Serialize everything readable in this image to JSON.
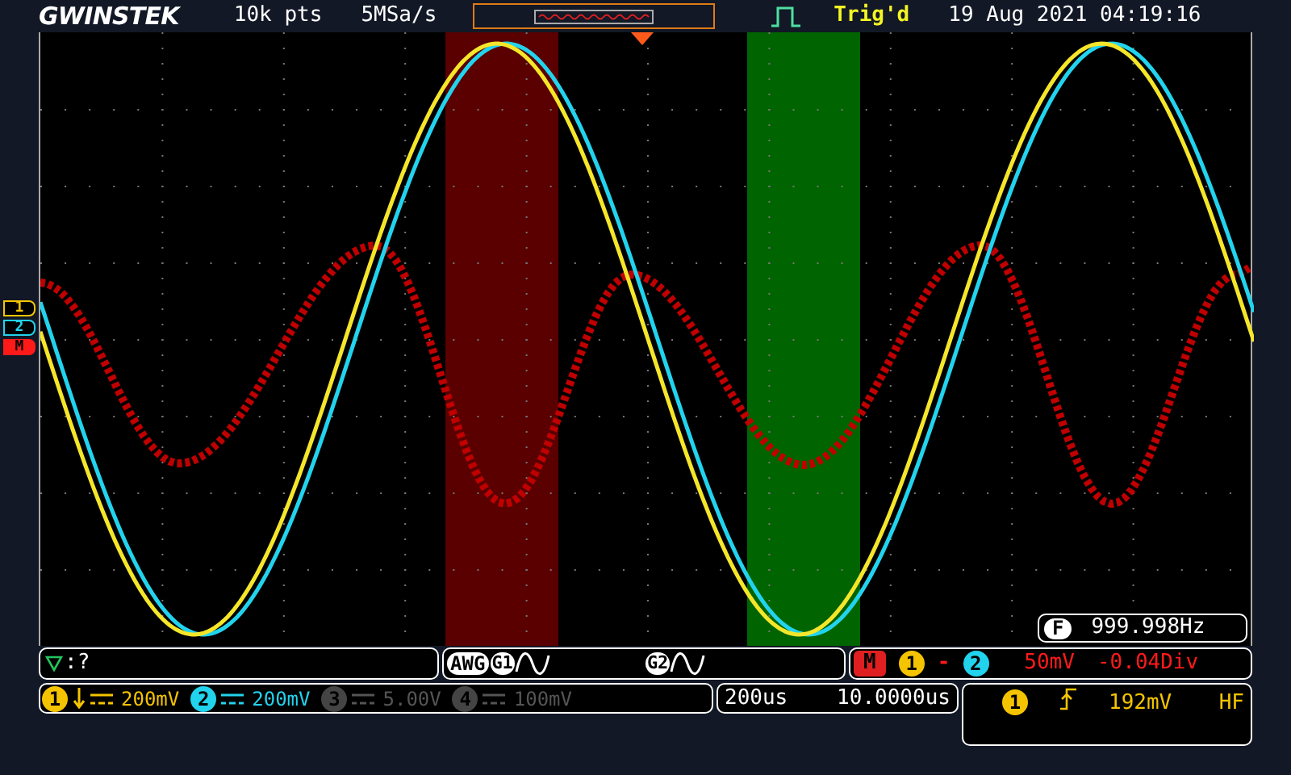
{
  "header": {
    "brand": "GWINSTEK",
    "record_length": "10k pts",
    "sample_rate": "5MSa/s",
    "trigger_status": "Trig'd",
    "datetime": "19 Aug 2021 04:19:16"
  },
  "markers": [
    {
      "label": "1",
      "color": "#f5c400"
    },
    {
      "label": "2",
      "color": "#22d3ee"
    },
    {
      "label": "M",
      "color": "#ff1a1a"
    }
  ],
  "frequency": {
    "label": "F",
    "value": "999.998Hz"
  },
  "bus": {
    "text": ":?"
  },
  "awg": {
    "label": "AWG",
    "generators": [
      "G1",
      "G2"
    ]
  },
  "math": {
    "label": "M",
    "source_a": "1",
    "operator": "-",
    "source_b": "2",
    "scale": "50mV",
    "offset": "-0.04Div"
  },
  "channels": [
    {
      "number": "1",
      "inverted": true,
      "on": true,
      "color": "#f5c400",
      "scale": "200mV"
    },
    {
      "number": "2",
      "inverted": false,
      "on": true,
      "color": "#22d3ee",
      "scale": "200mV"
    },
    {
      "number": "3",
      "inverted": false,
      "on": false,
      "color": "#444444",
      "scale": "5.00V"
    },
    {
      "number": "4",
      "inverted": false,
      "on": false,
      "color": "#444444",
      "scale": "100mV"
    }
  ],
  "timebase": {
    "scale": "200us",
    "position": "10.0000us"
  },
  "trigger": {
    "source": "1",
    "level": "192mV",
    "coupling": "HF"
  }
}
